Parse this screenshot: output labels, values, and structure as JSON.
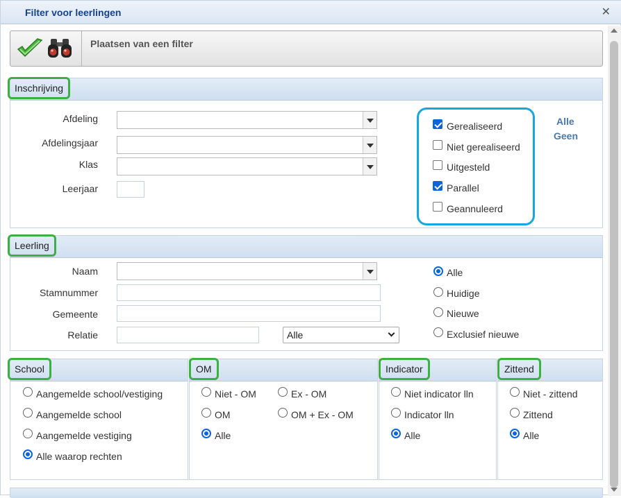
{
  "window": {
    "title": "Filter voor leerlingen",
    "close_glyph": "✕"
  },
  "toolbar": {
    "label": "Plaatsen van een filter",
    "icons": [
      "checkmark-icon",
      "binoculars-icon"
    ]
  },
  "inschrijving": {
    "title": "Inschrijving",
    "afdeling_label": "Afdeling",
    "afdelingsjaar_label": "Afdelingsjaar",
    "klas_label": "Klas",
    "leerjaar_label": "Leerjaar",
    "checks": [
      {
        "label": "Gerealiseerd",
        "checked": true
      },
      {
        "label": "Niet gerealiseerd",
        "checked": false
      },
      {
        "label": "Uitgesteld",
        "checked": false
      },
      {
        "label": "Parallel",
        "checked": true
      },
      {
        "label": "Geannuleerd",
        "checked": false
      }
    ],
    "alle_link": "Alle",
    "geen_link": "Geen"
  },
  "leerling": {
    "title": "Leerling",
    "naam_label": "Naam",
    "stamnummer_label": "Stamnummer",
    "gemeente_label": "Gemeente",
    "relatie_label": "Relatie",
    "relatie_select_value": "Alle",
    "radios": [
      {
        "label": "Alle",
        "checked": true
      },
      {
        "label": "Huidige",
        "checked": false
      },
      {
        "label": "Nieuwe",
        "checked": false
      },
      {
        "label": "Exclusief nieuwe",
        "checked": false
      }
    ]
  },
  "school": {
    "title": "School",
    "radios": [
      {
        "label": "Aangemelde school/vestiging",
        "checked": false
      },
      {
        "label": "Aangemelde school",
        "checked": false
      },
      {
        "label": "Aangemelde vestiging",
        "checked": false
      },
      {
        "label": "Alle waarop rechten",
        "checked": true
      }
    ]
  },
  "om": {
    "title": "OM",
    "radios": [
      {
        "label": "Niet - OM",
        "checked": false
      },
      {
        "label": "Ex - OM",
        "checked": false
      },
      {
        "label": "OM",
        "checked": false
      },
      {
        "label": "OM + Ex - OM",
        "checked": false
      },
      {
        "label": "Alle",
        "checked": true
      }
    ]
  },
  "indicator": {
    "title": "Indicator",
    "radios": [
      {
        "label": "Niet indicator lln",
        "checked": false
      },
      {
        "label": "Indicator lln",
        "checked": false
      },
      {
        "label": "Alle",
        "checked": true
      }
    ]
  },
  "zittend": {
    "title": "Zittend",
    "radios": [
      {
        "label": "Niet - zittend",
        "checked": false
      },
      {
        "label": "Zittend",
        "checked": false
      },
      {
        "label": "Alle",
        "checked": true
      }
    ]
  },
  "colors": {
    "green_highlight": "#3cb043",
    "blue_highlight": "#16a6e0",
    "accent": "#0a66d8",
    "title_text": "#15428b"
  }
}
